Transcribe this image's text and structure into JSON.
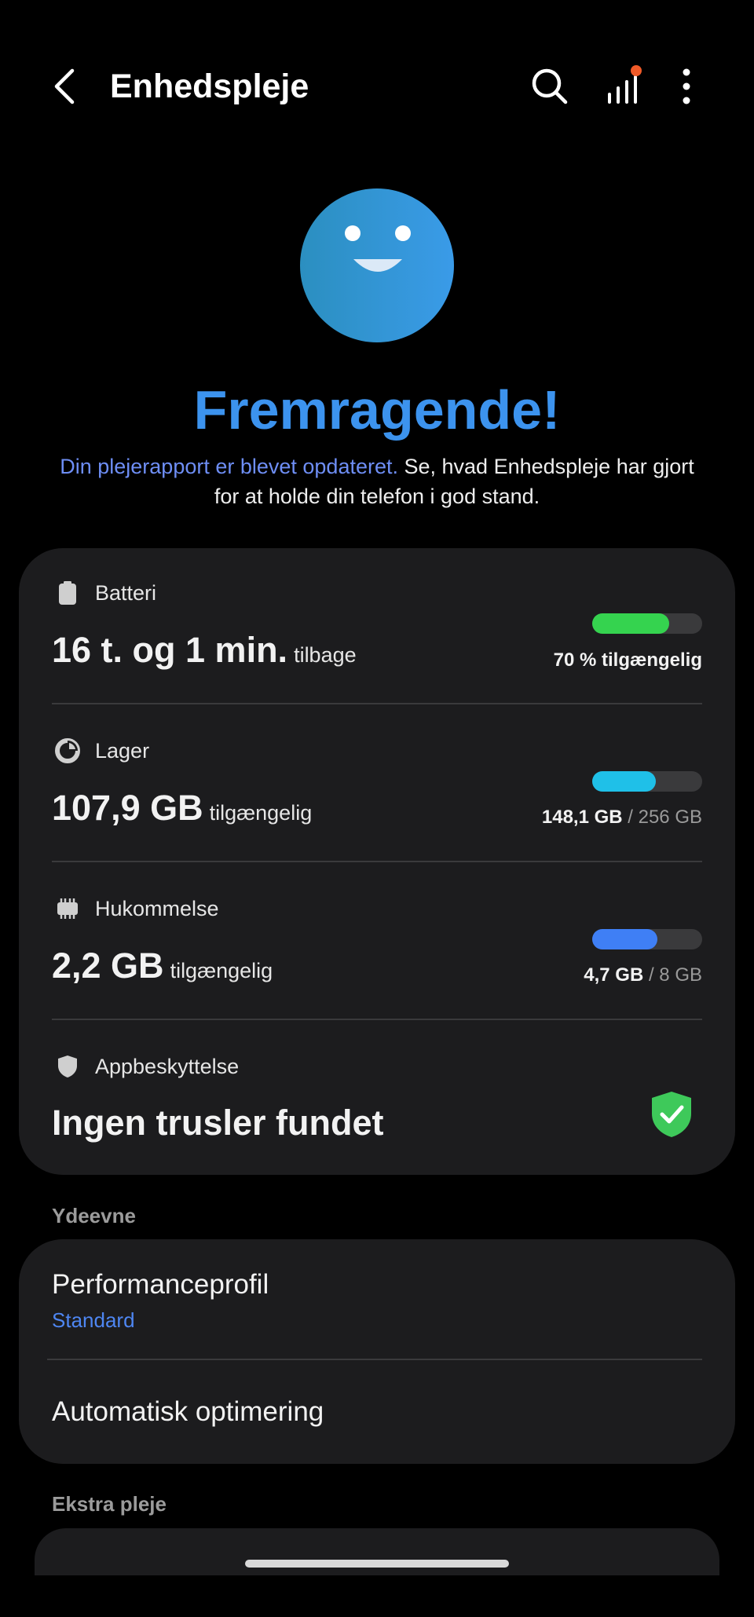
{
  "header": {
    "title": "Enhedspleje",
    "icons": [
      "back-icon",
      "search-icon",
      "stats-icon",
      "more-icon"
    ],
    "notification_dot_color": "#f05a28"
  },
  "hero": {
    "status": "Fremragende!",
    "desc_link": "Din plejerapport er blevet opdateret.",
    "desc_rest": " Se, hvad Enhedspleje har gjort for at holde din telefon i god stand."
  },
  "overview": {
    "battery": {
      "label": "Batteri",
      "value": "16 t. og 1 min.",
      "suffix": "tilbage",
      "right_bold": "70 % tilgængelig",
      "level": 0.7,
      "color": "#35d34f"
    },
    "storage": {
      "label": "Lager",
      "value": "107,9 GB",
      "suffix": "tilgængelig",
      "right_bold": "148,1 GB",
      "right_rest": " / 256 GB",
      "level": 0.58,
      "color": "#1fc0e8"
    },
    "memory": {
      "label": "Hukommelse",
      "value": "2,2 GB",
      "suffix": "tilgængelig",
      "right_bold": "4,7 GB",
      "right_rest": " / 8 GB",
      "level": 0.59,
      "color": "#3f7ff5"
    },
    "protection": {
      "label": "Appbeskyttelse",
      "value": "Ingen trusler fundet",
      "shield_color": "#3ec95a"
    }
  },
  "performance": {
    "section_title": "Ydeevne",
    "profile_title": "Performanceprofil",
    "profile_value": "Standard",
    "auto_title": "Automatisk optimering"
  },
  "extra": {
    "section_title": "Ekstra pleje"
  }
}
